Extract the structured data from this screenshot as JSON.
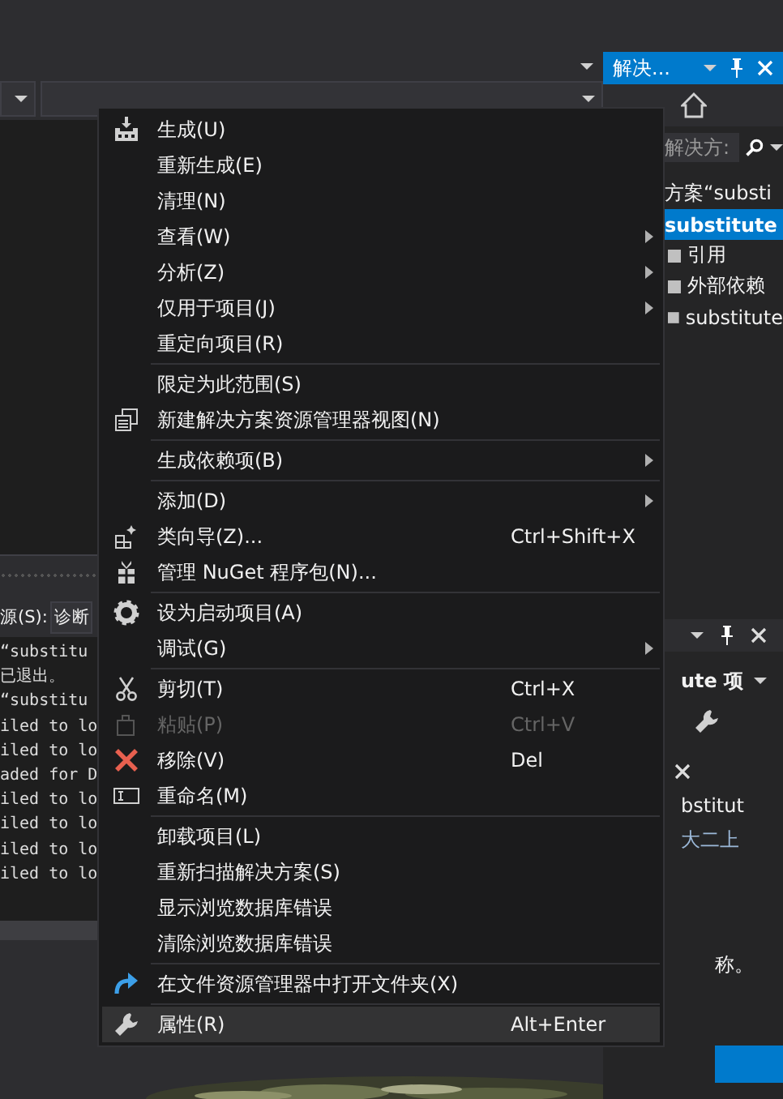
{
  "editor": {
    "output": {
      "source_label": "源(S):",
      "source_value": "诊断",
      "lines": [
        "“substitu",
        "已退出。",
        "“substitu",
        "iled to lo",
        "iled to lo",
        "aded for D",
        "iled to lo",
        "iled to lo",
        "iled to lo",
        "iled to lo"
      ]
    }
  },
  "solution_explorer": {
    "title": "解决...",
    "search": {
      "placeholder": "解决方:"
    },
    "tree": [
      {
        "label": "方案“substi",
        "selected": false,
        "children": [
          {
            "label": "substitute",
            "selected": true,
            "children": [
              {
                "label": "引用",
                "selected": false
              },
              {
                "label": "外部依赖",
                "selected": false
              },
              {
                "label": "substitute",
                "selected": false
              }
            ]
          }
        ]
      }
    ]
  },
  "properties": {
    "object": "ute 项",
    "popup_text": "bstitut",
    "popup_link": "大二上",
    "note": "称。"
  },
  "context_menu": {
    "groups": [
      [
        {
          "label": "生成(U)",
          "submenu": false,
          "disabled": false,
          "selected": false
        },
        {
          "label": "重新生成(E)",
          "submenu": false,
          "disabled": false,
          "selected": false
        },
        {
          "label": "清理(N)",
          "submenu": false,
          "disabled": false,
          "selected": false
        },
        {
          "label": "查看(W)",
          "submenu": true,
          "disabled": false,
          "selected": false
        },
        {
          "label": "分析(Z)",
          "submenu": true,
          "disabled": false,
          "selected": false
        },
        {
          "label": "仅用于项目(J)",
          "submenu": true,
          "disabled": false,
          "selected": false
        },
        {
          "label": "重定向项目(R)",
          "submenu": false,
          "disabled": false,
          "selected": false
        }
      ],
      [
        {
          "label": "限定为此范围(S)",
          "submenu": false,
          "disabled": false,
          "selected": false
        },
        {
          "label": "新建解决方案资源管理器视图(N)",
          "submenu": false,
          "disabled": false,
          "selected": false
        }
      ],
      [
        {
          "label": "生成依赖项(B)",
          "submenu": true,
          "disabled": false,
          "selected": false
        }
      ],
      [
        {
          "label": "添加(D)",
          "submenu": true,
          "disabled": false,
          "selected": false
        },
        {
          "label": "类向导(Z)...",
          "shortcut": "Ctrl+Shift+X",
          "submenu": false,
          "disabled": false,
          "selected": false
        },
        {
          "label": "管理 NuGet 程序包(N)...",
          "submenu": false,
          "disabled": false,
          "selected": false
        }
      ],
      [
        {
          "label": "设为启动项目(A)",
          "submenu": false,
          "disabled": false,
          "selected": false
        },
        {
          "label": "调试(G)",
          "submenu": true,
          "disabled": false,
          "selected": false
        }
      ],
      [
        {
          "label": "剪切(T)",
          "shortcut": "Ctrl+X",
          "submenu": false,
          "disabled": false,
          "selected": false
        },
        {
          "label": "粘贴(P)",
          "shortcut": "Ctrl+V",
          "submenu": false,
          "disabled": true,
          "selected": false
        },
        {
          "label": "移除(V)",
          "shortcut": "Del",
          "submenu": false,
          "disabled": false,
          "selected": false
        },
        {
          "label": "重命名(M)",
          "submenu": false,
          "disabled": false,
          "selected": false
        }
      ],
      [
        {
          "label": "卸载项目(L)",
          "submenu": false,
          "disabled": false,
          "selected": false
        },
        {
          "label": "重新扫描解决方案(S)",
          "submenu": false,
          "disabled": false,
          "selected": false
        },
        {
          "label": "显示浏览数据库错误",
          "submenu": false,
          "disabled": false,
          "selected": false
        },
        {
          "label": "清除浏览数据库错误",
          "submenu": false,
          "disabled": false,
          "selected": false
        }
      ],
      [
        {
          "label": "在文件资源管理器中打开文件夹(X)",
          "submenu": false,
          "disabled": false,
          "selected": false
        }
      ],
      [
        {
          "label": "属性(R)",
          "shortcut": "Alt+Enter",
          "submenu": false,
          "disabled": false,
          "selected": true
        }
      ]
    ]
  }
}
